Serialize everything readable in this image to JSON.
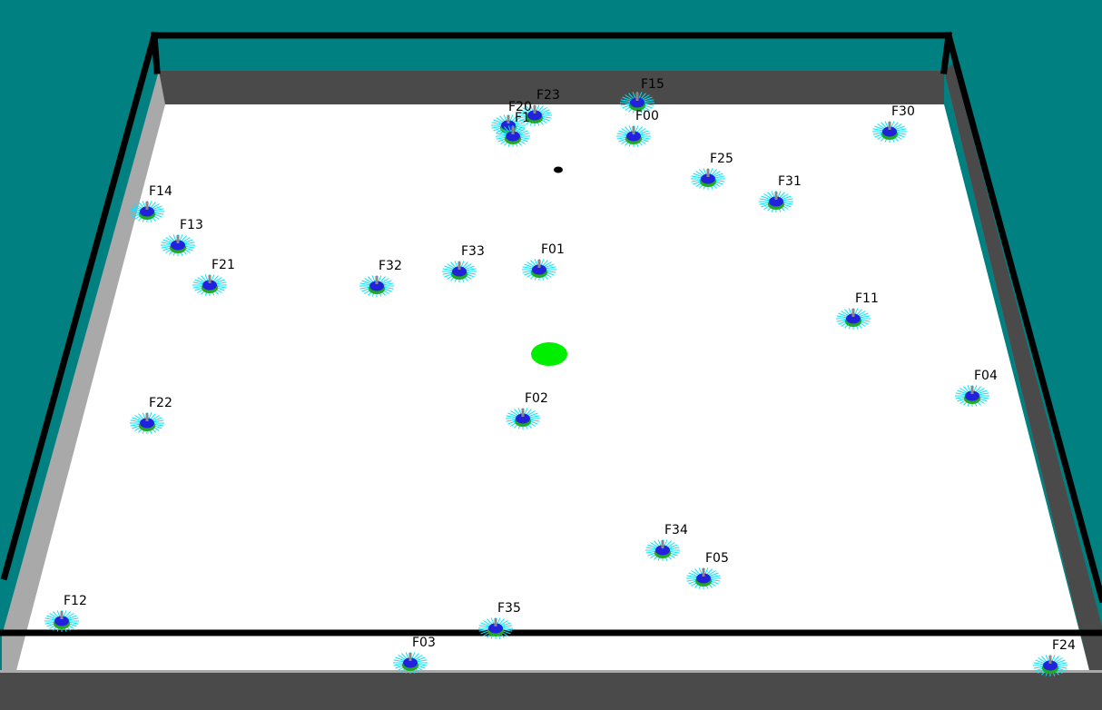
{
  "colors": {
    "background": "#008080",
    "floor": "#ffffff",
    "wall_top": "#4a4a4a",
    "wall_side": "#a9a9a9",
    "frame": "#000000",
    "target": "#00ee00",
    "robot_body": "#2222dd",
    "robot_base": "#22aa22",
    "sensor_rays": "#00e5ff",
    "antenna": "#888888"
  },
  "target": {
    "name": "green-target-disc"
  },
  "obstacle": {
    "name": "black-dot"
  },
  "robots": [
    {
      "id": "F15"
    },
    {
      "id": "F23"
    },
    {
      "id": "F20"
    },
    {
      "id": "F1"
    },
    {
      "id": "F00"
    },
    {
      "id": "F30"
    },
    {
      "id": "F25"
    },
    {
      "id": "F31"
    },
    {
      "id": "F14"
    },
    {
      "id": "F13"
    },
    {
      "id": "F21"
    },
    {
      "id": "F32"
    },
    {
      "id": "F33"
    },
    {
      "id": "F01"
    },
    {
      "id": "F11"
    },
    {
      "id": "F04"
    },
    {
      "id": "F22"
    },
    {
      "id": "F02"
    },
    {
      "id": "F34"
    },
    {
      "id": "F05"
    },
    {
      "id": "F12"
    },
    {
      "id": "F35"
    },
    {
      "id": "F03"
    },
    {
      "id": "F24"
    }
  ]
}
